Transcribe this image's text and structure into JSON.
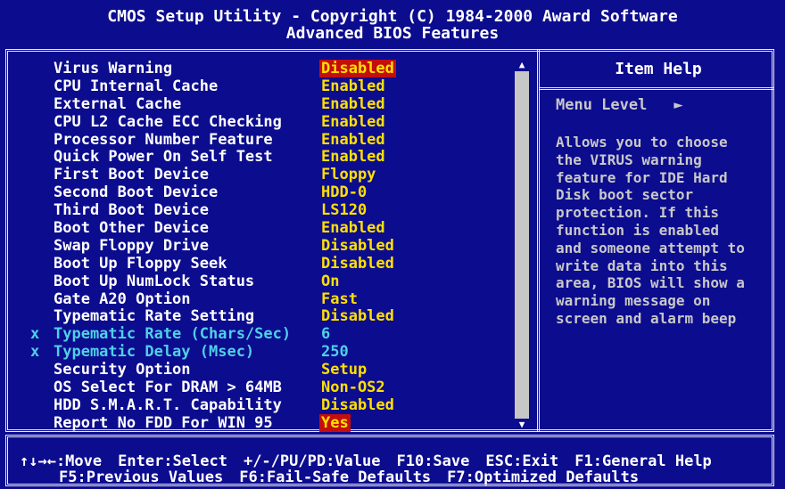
{
  "header": {
    "line1": "CMOS Setup Utility - Copyright (C) 1984-2000 Award Software",
    "line2": "Advanced BIOS Features"
  },
  "settings": [
    {
      "label": "Virus Warning",
      "value": "Disabled",
      "selected": true,
      "disabled": false
    },
    {
      "label": "CPU Internal Cache",
      "value": "Enabled",
      "disabled": false
    },
    {
      "label": "External Cache",
      "value": "Enabled",
      "disabled": false
    },
    {
      "label": "CPU L2 Cache ECC Checking",
      "value": "Enabled",
      "disabled": false
    },
    {
      "label": "Processor Number Feature",
      "value": "Enabled",
      "disabled": false
    },
    {
      "label": "Quick Power On Self Test",
      "value": "Enabled",
      "disabled": false
    },
    {
      "label": "First Boot Device",
      "value": "Floppy",
      "disabled": false
    },
    {
      "label": "Second Boot Device",
      "value": "HDD-0",
      "disabled": false
    },
    {
      "label": "Third Boot Device",
      "value": "LS120",
      "disabled": false
    },
    {
      "label": "Boot Other Device",
      "value": "Enabled",
      "disabled": false
    },
    {
      "label": "Swap Floppy Drive",
      "value": "Disabled",
      "disabled": false
    },
    {
      "label": "Boot Up Floppy Seek",
      "value": "Disabled",
      "disabled": false
    },
    {
      "label": "Boot Up NumLock Status",
      "value": "On",
      "disabled": false
    },
    {
      "label": "Gate A20 Option",
      "value": "Fast",
      "disabled": false
    },
    {
      "label": "Typematic Rate Setting",
      "value": "Disabled",
      "disabled": false
    },
    {
      "label": "Typematic Rate (Chars/Sec)",
      "value": "6",
      "disabled": true
    },
    {
      "label": "Typematic Delay (Msec)",
      "value": "250",
      "disabled": true
    },
    {
      "label": "Security Option",
      "value": "Setup",
      "disabled": false
    },
    {
      "label": "OS Select For DRAM > 64MB",
      "value": "Non-OS2",
      "disabled": false
    },
    {
      "label": "HDD S.M.A.R.T. Capability",
      "value": "Disabled",
      "disabled": false
    },
    {
      "label": "Report No FDD For WIN 95",
      "value": "Yes",
      "selected": true,
      "disabled": false
    }
  ],
  "disabled_marker": "x",
  "help": {
    "title": "Item Help",
    "menu_level_label": "Menu Level",
    "menu_level_marker": "►",
    "text_lines": [
      "Allows you to choose",
      "the VIRUS warning",
      "feature for IDE Hard",
      "Disk boot sector",
      "protection. If this",
      "function is enabled",
      "and someone attempt to",
      "write data into this",
      "area, BIOS will show a",
      "warning message on",
      "screen and alarm beep"
    ]
  },
  "scrollbar": {
    "up_icon": "▲",
    "down_icon": "▼"
  },
  "footer": {
    "line1": [
      "↑↓→←:Move",
      "Enter:Select",
      "+/-/PU/PD:Value",
      "F10:Save",
      "ESC:Exit",
      "F1:General Help"
    ],
    "line2": [
      "F5:Previous Values",
      "F6:Fail-Safe Defaults",
      "F7:Optimized Defaults"
    ]
  },
  "colors": {
    "background": "#0c0c8e",
    "label": "#ffffff",
    "value": "#ffe000",
    "selected_bg": "#c40e0e",
    "disabled": "#4fd0e8",
    "help_text": "#c8c8c8"
  }
}
